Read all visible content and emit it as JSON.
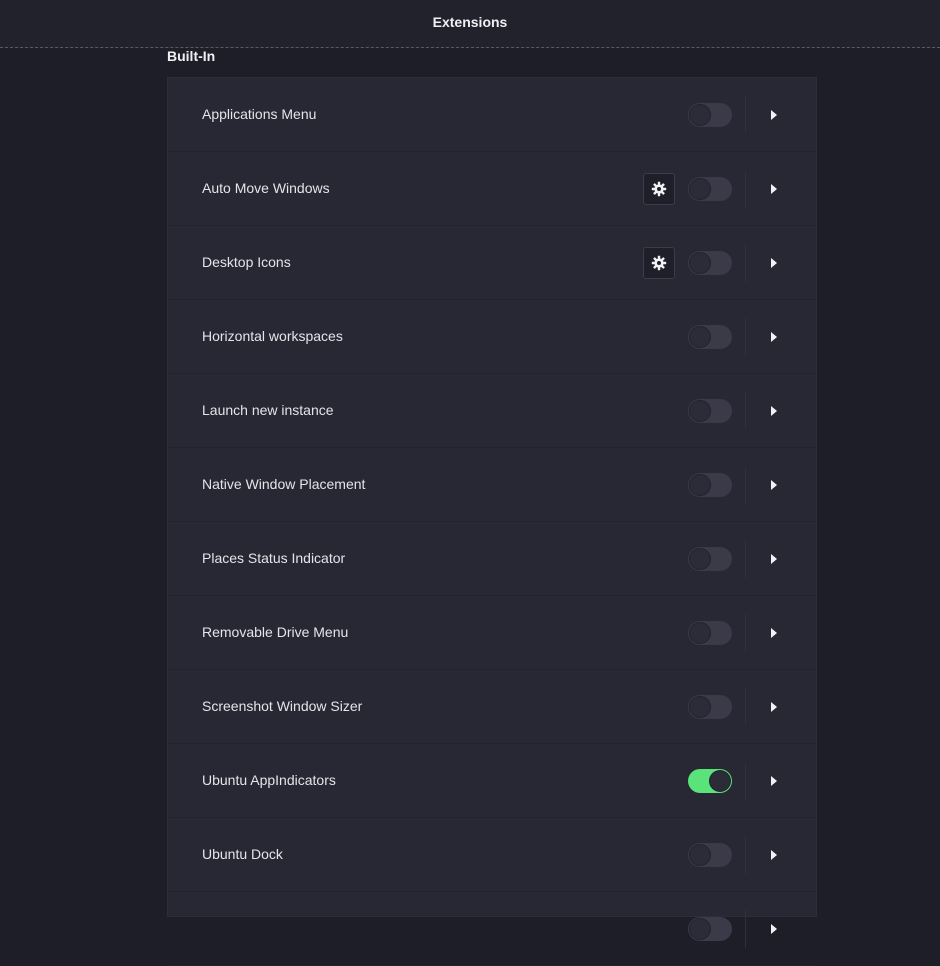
{
  "window": {
    "title": "Extensions"
  },
  "section": {
    "title": "Built-In"
  },
  "colors": {
    "accent_on": "#5ae37a",
    "background": "#1e1e28",
    "list_background": "#282834"
  },
  "extensions": [
    {
      "name": "Applications Menu",
      "enabled": false,
      "has_settings": false
    },
    {
      "name": "Auto Move Windows",
      "enabled": false,
      "has_settings": true
    },
    {
      "name": "Desktop Icons",
      "enabled": false,
      "has_settings": true
    },
    {
      "name": "Horizontal workspaces",
      "enabled": false,
      "has_settings": false
    },
    {
      "name": "Launch new instance",
      "enabled": false,
      "has_settings": false
    },
    {
      "name": "Native Window Placement",
      "enabled": false,
      "has_settings": false
    },
    {
      "name": "Places Status Indicator",
      "enabled": false,
      "has_settings": false
    },
    {
      "name": "Removable Drive Menu",
      "enabled": false,
      "has_settings": false
    },
    {
      "name": "Screenshot Window Sizer",
      "enabled": false,
      "has_settings": false
    },
    {
      "name": "Ubuntu AppIndicators",
      "enabled": true,
      "has_settings": false
    },
    {
      "name": "Ubuntu Dock",
      "enabled": false,
      "has_settings": false
    },
    {
      "name": "",
      "enabled": false,
      "has_settings": false
    }
  ],
  "icons": {
    "settings": "gear-icon",
    "expand": "chevron-right-icon"
  }
}
